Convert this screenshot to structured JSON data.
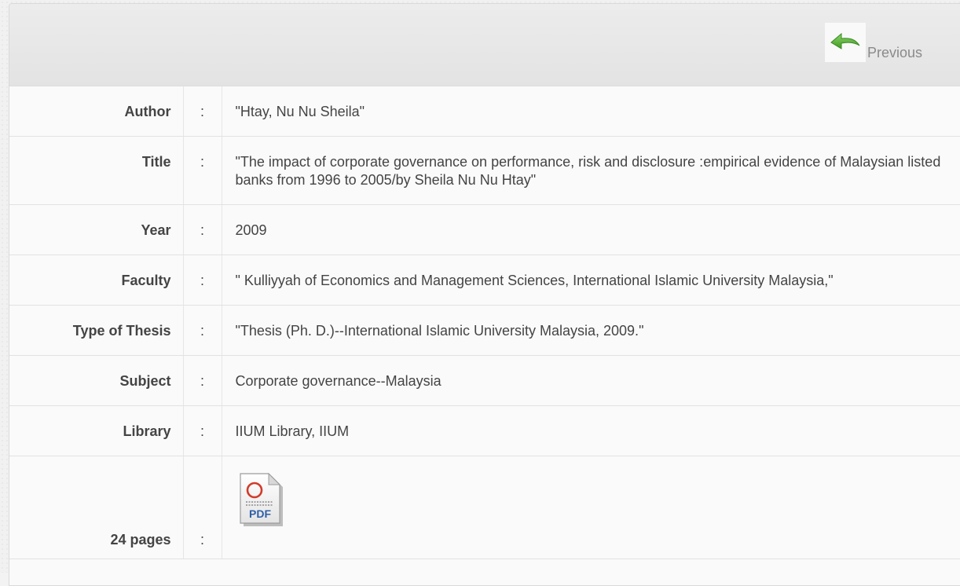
{
  "header": {
    "previous_label": "Previous",
    "previous_icon": "green-back-arrow-icon"
  },
  "record": {
    "author": {
      "label": "Author",
      "separator": ":",
      "value": "\"Htay, Nu Nu Sheila\""
    },
    "title": {
      "label": "Title",
      "separator": ":",
      "value": "\"The impact of corporate governance on performance, risk and disclosure :empirical evidence of Malaysian listed banks from 1996 to 2005/by Sheila Nu Nu Htay\""
    },
    "year": {
      "label": "Year",
      "separator": ":",
      "value": "2009"
    },
    "faculty": {
      "label": "Faculty",
      "separator": ":",
      "value": "\" Kulliyyah of Economics and Management Sciences, International Islamic University Malaysia,\""
    },
    "thesis_type": {
      "label": "Type of Thesis",
      "separator": ":",
      "value": "\"Thesis (Ph. D.)--International Islamic University Malaysia, 2009.\""
    },
    "subject": {
      "label": "Subject",
      "separator": ":",
      "value": "Corporate governance--Malaysia"
    },
    "library": {
      "label": "Library",
      "separator": ":",
      "value": "IIUM Library, IIUM"
    },
    "pages": {
      "label": "24 pages",
      "separator": ":",
      "file_icon": "pdf-file-icon",
      "file_text": "PDF"
    }
  },
  "colors": {
    "arrow_green": "#4fae2e",
    "pdf_red": "#d23a2a",
    "pdf_blue": "#2d5fa8"
  }
}
